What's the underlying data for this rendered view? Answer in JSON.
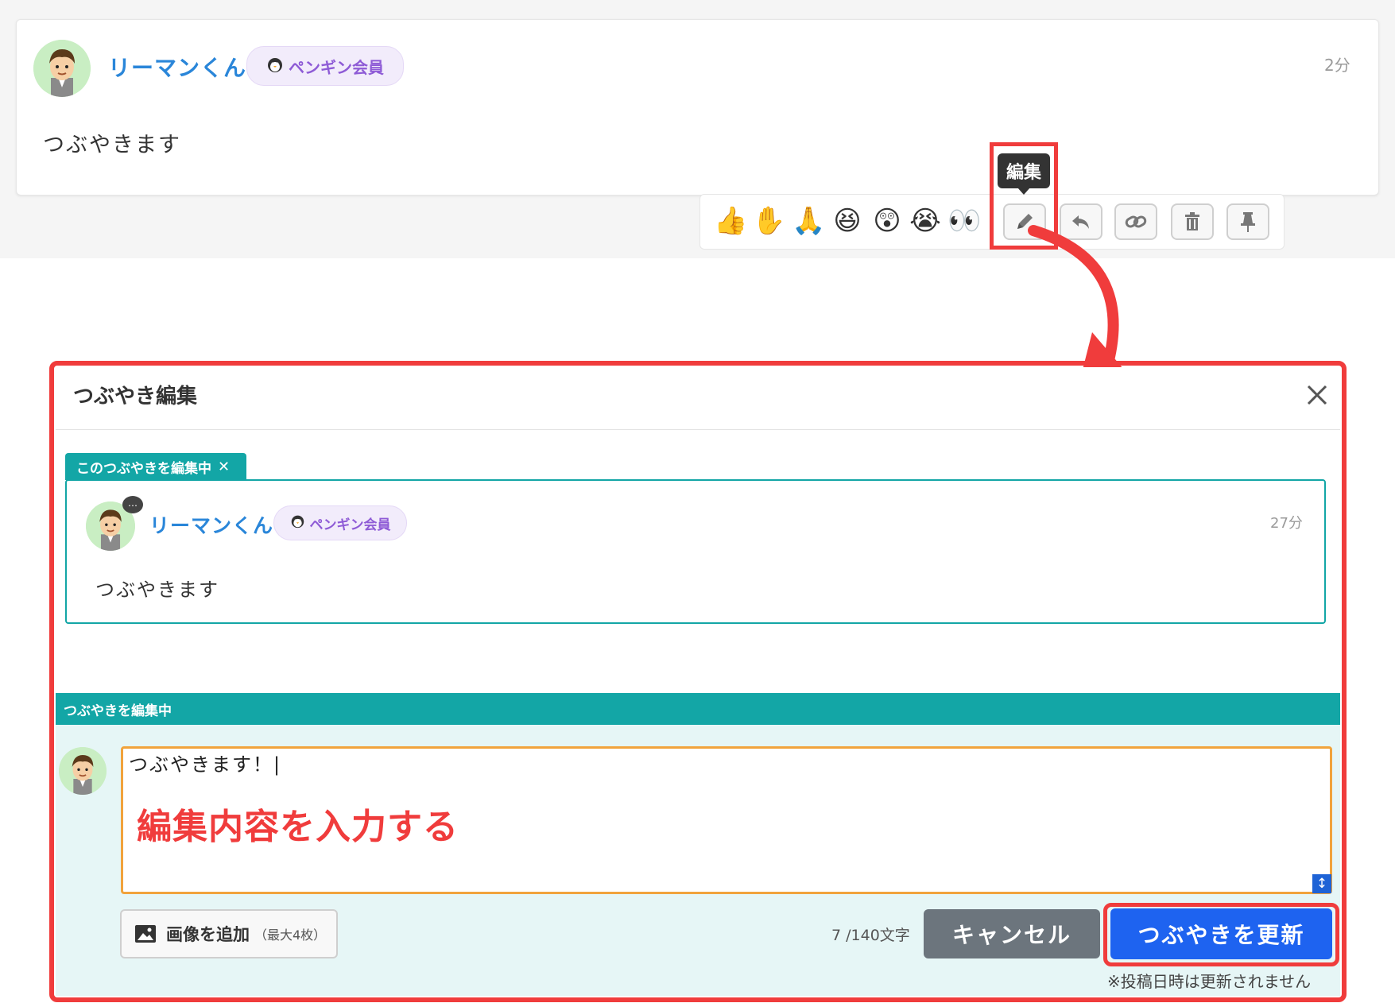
{
  "post": {
    "user_name": "リーマンくん",
    "badge_label": "ペンギン会員",
    "time": "2分",
    "text": "つぶやきます"
  },
  "reaction_bar": {
    "emojis": [
      "👍",
      "✋",
      "🙏",
      "😆",
      "😲",
      "😭",
      "👀"
    ],
    "tooltip": "編集",
    "tools": [
      "pencil-icon",
      "reply-icon",
      "link-icon",
      "trash-icon",
      "pin-icon"
    ]
  },
  "modal": {
    "title": "つぶやき編集",
    "editing_tag": "このつぶやきを編集中",
    "quoted": {
      "user_name": "リーマンくん",
      "badge_label": "ペンギン会員",
      "time": "27分",
      "text": "つぶやきます"
    },
    "composer_label": "つぶやきを編集中",
    "textarea_value": "つぶやきます！|",
    "annotation": "編集内容を入力する",
    "add_image_label": "画像を追加",
    "add_image_note": "（最大4枚）",
    "char_count": "7 /140文字",
    "cancel_label": "キャンセル",
    "update_label": "つぶやきを更新",
    "update_note": "※投稿日時は更新されません"
  },
  "colors": {
    "accent_teal": "#13a6a6",
    "highlight_red": "#f03c3c",
    "primary_blue": "#1e63f0",
    "textarea_border": "#f1a33c"
  }
}
